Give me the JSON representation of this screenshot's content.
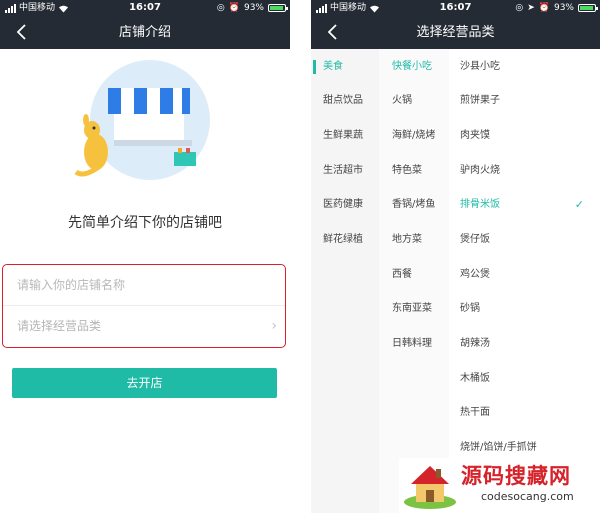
{
  "status": {
    "carrier": "中国移动",
    "time": "16:07",
    "battery": "93%"
  },
  "screen1": {
    "title": "店铺介绍",
    "intro": "先简单介绍下你的店铺吧",
    "name_placeholder": "请输入你的店铺名称",
    "category_placeholder": "请选择经营品类",
    "button": "去开店"
  },
  "screen2": {
    "title": "选择经营品类",
    "categories": [
      "美食",
      "甜点饮品",
      "生鲜果蔬",
      "生活超市",
      "医药健康",
      "鲜花绿植"
    ],
    "subcategories": [
      "快餐小吃",
      "火锅",
      "海鲜/烧烤",
      "特色菜",
      "香锅/烤鱼",
      "地方菜",
      "西餐",
      "东南亚菜",
      "日韩料理"
    ],
    "items": [
      "沙县小吃",
      "煎饼果子",
      "肉夹馍",
      "驴肉火烧",
      "排骨米饭",
      "煲仔饭",
      "鸡公煲",
      "砂锅",
      "胡辣汤",
      "木桶饭",
      "热干面",
      "烧饼/馅饼/手抓饼"
    ],
    "selected_item_index": 4
  },
  "watermark": {
    "cn": "源码搜藏网",
    "en": "codesocang.com"
  },
  "colors": {
    "bar": "#252b35",
    "accent": "#1fbba6",
    "highlight": "#d8212b"
  }
}
